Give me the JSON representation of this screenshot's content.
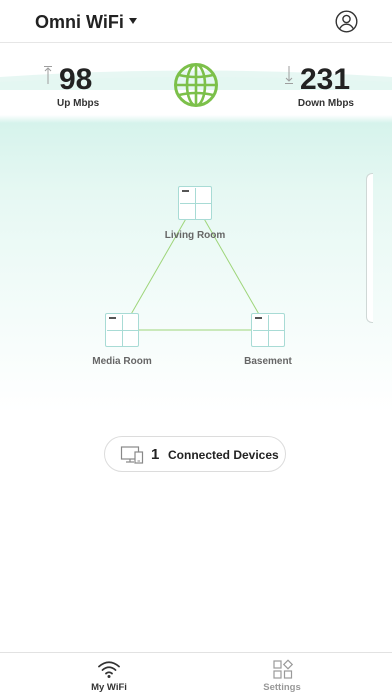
{
  "header": {
    "network_name": "Omni WiFi"
  },
  "speed": {
    "up": {
      "value": "98",
      "label": "Up Mbps"
    },
    "down": {
      "value": "231",
      "label": "Down Mbps"
    }
  },
  "topology": {
    "nodes": [
      {
        "name": "Living Room"
      },
      {
        "name": "Media Room"
      },
      {
        "name": "Basement"
      }
    ]
  },
  "connected": {
    "count": "1",
    "label": "Connected Devices"
  },
  "tabs": [
    {
      "label": "My WiFi",
      "active": true
    },
    {
      "label": "Settings",
      "active": false
    }
  ],
  "colors": {
    "globe": "#7cc04a",
    "node_border": "#a8dbd5",
    "link_line": "#9ed57a",
    "hero_tint": "#dff5ef"
  },
  "icons": {
    "account": "account-circle-icon",
    "globe": "globe-icon",
    "devices": "devices-icon",
    "wifi": "wifi-icon",
    "settings": "settings-grid-icon"
  }
}
